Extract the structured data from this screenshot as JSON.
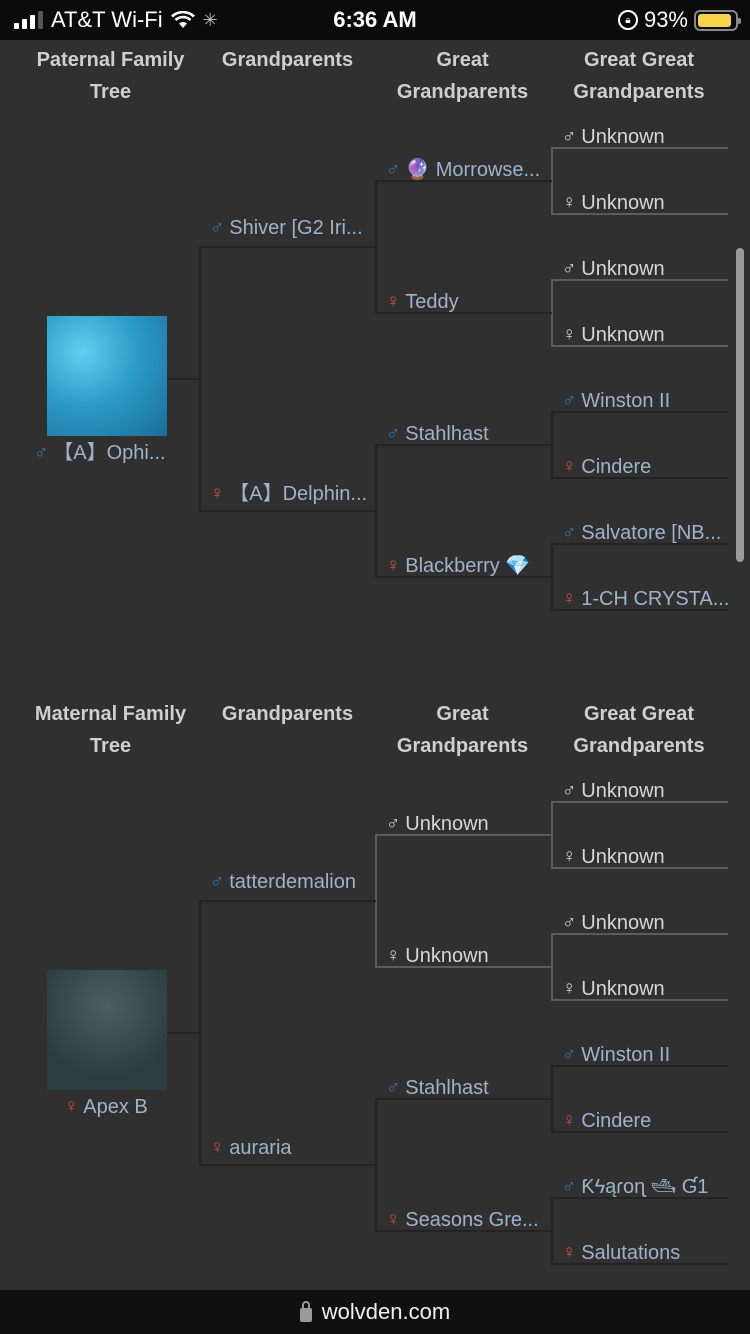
{
  "status_bar": {
    "carrier": "AT&T Wi-Fi",
    "time": "6:36 AM",
    "battery": "93%",
    "battery_level": 0.93,
    "signal_bars": 3
  },
  "symbols": {
    "male": "♂",
    "female": "♀"
  },
  "paternal": {
    "headers": [
      "Paternal Family Tree",
      "Grandparents",
      "Great Grandparents",
      "Great Great Grandparents"
    ],
    "subject": {
      "name": "【A】Ophi...",
      "sex": "male"
    },
    "grandparents": [
      {
        "name": "Shiver [G2 Iri...",
        "sex": "male"
      },
      {
        "name": "【A】Delphin...",
        "sex": "female"
      }
    ],
    "great_grandparents": [
      {
        "name": "🔮 Morrowse...",
        "sex": "male"
      },
      {
        "name": "Teddy",
        "sex": "female"
      },
      {
        "name": "Stahlhast",
        "sex": "male"
      },
      {
        "name": "Blackberry 💎",
        "sex": "female"
      }
    ],
    "great_great_grandparents": [
      {
        "name": "Unknown",
        "sex": "male",
        "unknown": true
      },
      {
        "name": "Unknown",
        "sex": "female",
        "unknown": true
      },
      {
        "name": "Unknown",
        "sex": "male",
        "unknown": true
      },
      {
        "name": "Unknown",
        "sex": "female",
        "unknown": true
      },
      {
        "name": "Winston II",
        "sex": "male"
      },
      {
        "name": "Cindere",
        "sex": "female"
      },
      {
        "name": "Salvatore [NB...",
        "sex": "male"
      },
      {
        "name": "1-CH CRYSTA...",
        "sex": "female"
      }
    ]
  },
  "maternal": {
    "headers": [
      "Maternal Family Tree",
      "Grandparents",
      "Great Grandparents",
      "Great Great Grandparents"
    ],
    "subject": {
      "name": "Apex B",
      "sex": "female"
    },
    "grandparents": [
      {
        "name": "tatterdemalion",
        "sex": "male"
      },
      {
        "name": "auraria",
        "sex": "female"
      }
    ],
    "great_grandparents": [
      {
        "name": "Unknown",
        "sex": "male",
        "unknown": true
      },
      {
        "name": "Unknown",
        "sex": "female",
        "unknown": true
      },
      {
        "name": "Stahlhast",
        "sex": "male"
      },
      {
        "name": "Seasons Gre...",
        "sex": "female"
      }
    ],
    "great_great_grandparents": [
      {
        "name": "Unknown",
        "sex": "male",
        "unknown": true
      },
      {
        "name": "Unknown",
        "sex": "female",
        "unknown": true
      },
      {
        "name": "Unknown",
        "sex": "male",
        "unknown": true
      },
      {
        "name": "Unknown",
        "sex": "female",
        "unknown": true
      },
      {
        "name": "Winston II",
        "sex": "male"
      },
      {
        "name": "Cindere",
        "sex": "female"
      },
      {
        "name": "Ƙϟąɾoɳ 🛥 Ɠ1",
        "sex": "male"
      },
      {
        "name": "Salutations",
        "sex": "female"
      }
    ]
  },
  "url_bar": {
    "domain": "wolvden.com"
  }
}
